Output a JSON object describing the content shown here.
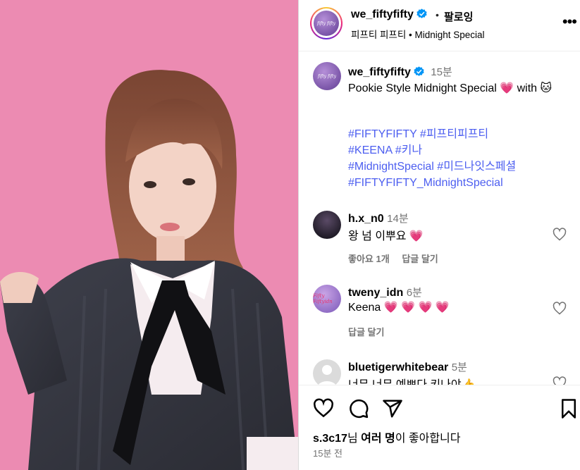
{
  "post": {
    "username": "we_fiftyfifty",
    "follow_label": "팔로잉",
    "audio": "피프티 피프티 • Midnight Special",
    "avatar_text": "fifty fifty"
  },
  "caption": {
    "username": "we_fiftyfifty",
    "time": "15분",
    "text": "Pookie Style Midnight Special 💗 with 🐱",
    "hashtags": [
      "#FIFTYFIFTY #피프티피프티",
      "#KEENA #키나",
      "#MidnightSpecial #미드나잇스페셜",
      "#FIFTYFIFTY_MidnightSpecial"
    ]
  },
  "comments": [
    {
      "username": "h.x_n0",
      "time": "14분",
      "text": "왕 넘 이뿌요 💗",
      "likes_label": "좋아요 1개",
      "reply_label": "답글 달기"
    },
    {
      "username": "tweny_idn",
      "time": "6분",
      "text": "Keena 💗 💗 💗 💗",
      "likes_label": "",
      "reply_label": "답글 달기",
      "avatar_text": "Fifty Fiftyidn"
    },
    {
      "username": "bluetigerwhitebear",
      "time": "5분",
      "text": "너무 너무 예쁘다 키나야👍",
      "likes_label": "",
      "reply_label": ""
    }
  ],
  "footer": {
    "likes_user": "s.3c17",
    "likes_mid": "님 ",
    "likes_bold": "여러 명",
    "likes_end": "이 좋아합니다",
    "posted": "15분 전"
  },
  "colors": {
    "background_pink": "#ec8bb2",
    "hashtag_blue": "#4c5ef0",
    "verified_blue": "#0095f6",
    "heart": "#ff3b74"
  },
  "icons": [
    "heart-icon",
    "comment-icon",
    "share-icon",
    "save-icon",
    "verified-icon",
    "more-icon"
  ]
}
